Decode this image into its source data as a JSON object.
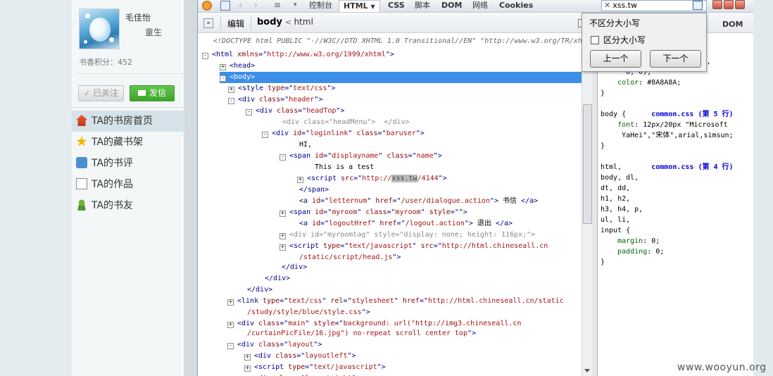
{
  "profile": {
    "username": "毛佳怡",
    "level": "童生",
    "points": "书香积分：452",
    "follow_label": "已关注",
    "message_label": "发信"
  },
  "nav": [
    {
      "label": "TA的书房首页",
      "icon": "home-icon"
    },
    {
      "label": "TA的藏书架",
      "icon": "star-icon"
    },
    {
      "label": "TA的书评",
      "icon": "chat-icon"
    },
    {
      "label": "TA的作品",
      "icon": "document-icon"
    },
    {
      "label": "TA的书友",
      "icon": "user-icon"
    }
  ],
  "firebug": {
    "tabs": [
      "控制台",
      "HTML",
      "CSS",
      "脚本",
      "DOM",
      "网络",
      "Cookies"
    ],
    "edit_label": "编辑",
    "breadcrumb_current": "body",
    "breadcrumb_parent": "html",
    "search_value": "xss.tw",
    "right_tabs_partial": "DOM"
  },
  "search_popup": {
    "option1": "不区分大小写",
    "option2": "区分大小写",
    "prev_label": "上一个",
    "next_label": "下一个"
  },
  "html_tree": {
    "doctype": "<!DOCTYPE html PUBLIC \"-//W3C//DTD XHTML 1.0 Transitional//EN\" \"http://www.w3.org/TR/xh",
    "lines": [
      {
        "toggle": "-",
        "parts": [
          [
            "t",
            "<html "
          ],
          [
            "a",
            "xmlns"
          ],
          [
            "t",
            "=\""
          ],
          [
            "v",
            "http://www.w3.org/1999/xhtml"
          ],
          [
            "t",
            "\">"
          ]
        ]
      },
      {
        "toggle": "+",
        "parts": [
          [
            "t",
            "<head>"
          ]
        ]
      },
      {
        "toggle": "-",
        "selected": true,
        "parts": [
          [
            "w",
            "<body>"
          ]
        ]
      },
      {
        "toggle": "+",
        "parts": [
          [
            "t",
            "<style "
          ],
          [
            "a",
            "type"
          ],
          [
            "t",
            "=\""
          ],
          [
            "v",
            "text/css"
          ],
          [
            "t",
            "\">"
          ]
        ]
      },
      {
        "toggle": "-",
        "parts": [
          [
            "t",
            "<div "
          ],
          [
            "a",
            "class"
          ],
          [
            "t",
            "=\""
          ],
          [
            "v",
            "header"
          ],
          [
            "t",
            "\">"
          ]
        ]
      },
      {
        "toggle": "-",
        "parts": [
          [
            "t",
            "<div "
          ],
          [
            "a",
            "class"
          ],
          [
            "t",
            "=\""
          ],
          [
            "v",
            "headTop"
          ],
          [
            "t",
            "\">"
          ]
        ]
      },
      {
        "toggle": "",
        "parts": [
          [
            "g",
            "<div class=\"headMenu\">  </div>"
          ]
        ]
      },
      {
        "toggle": "-",
        "parts": [
          [
            "t",
            "<div "
          ],
          [
            "a",
            "id"
          ],
          [
            "t",
            "=\""
          ],
          [
            "v",
            "loginlink"
          ],
          [
            "t",
            "\" "
          ],
          [
            "a",
            "class"
          ],
          [
            "t",
            "=\""
          ],
          [
            "v",
            "baruser"
          ],
          [
            "t",
            "\">"
          ]
        ]
      },
      {
        "toggle": "",
        "parts": [
          [
            "k",
            "HI,"
          ]
        ]
      },
      {
        "toggle": "-",
        "parts": [
          [
            "t",
            "<span "
          ],
          [
            "a",
            "id"
          ],
          [
            "t",
            "=\""
          ],
          [
            "v",
            "displayname"
          ],
          [
            "t",
            "\" "
          ],
          [
            "a",
            "class"
          ],
          [
            "t",
            "=\""
          ],
          [
            "v",
            "name"
          ],
          [
            "t",
            "\">"
          ]
        ]
      },
      {
        "toggle": "",
        "parts": [
          [
            "k",
            "This is a test"
          ]
        ]
      },
      {
        "toggle": "+",
        "parts": [
          [
            "t",
            "<script "
          ],
          [
            "a",
            "src"
          ],
          [
            "t",
            "=\""
          ],
          [
            "v",
            "http://"
          ],
          [
            "h",
            "xss.tw"
          ],
          [
            "v",
            "/4144"
          ],
          [
            "t",
            "\">"
          ]
        ]
      },
      {
        "toggle": "",
        "parts": [
          [
            "t",
            "</span>"
          ]
        ]
      },
      {
        "toggle": "",
        "parts": [
          [
            "t",
            "<a "
          ],
          [
            "a",
            "id"
          ],
          [
            "t",
            "=\""
          ],
          [
            "v",
            "letternum"
          ],
          [
            "t",
            "\" "
          ],
          [
            "a",
            "href"
          ],
          [
            "t",
            "=\""
          ],
          [
            "v",
            "/user/dialogue.action"
          ],
          [
            "t",
            "\"> "
          ],
          [
            "k",
            "书信"
          ],
          [
            "t",
            " </a>"
          ]
        ]
      },
      {
        "toggle": "+",
        "parts": [
          [
            "t",
            "<span "
          ],
          [
            "a",
            "id"
          ],
          [
            "t",
            "=\""
          ],
          [
            "v",
            "myroom"
          ],
          [
            "t",
            "\" "
          ],
          [
            "a",
            "class"
          ],
          [
            "t",
            "=\""
          ],
          [
            "v",
            "myroom"
          ],
          [
            "t",
            "\" "
          ],
          [
            "a",
            "style"
          ],
          [
            "t",
            "=\"\">"
          ]
        ]
      },
      {
        "toggle": "",
        "parts": [
          [
            "t",
            "<a "
          ],
          [
            "a",
            "id"
          ],
          [
            "t",
            "=\""
          ],
          [
            "v",
            "logoutHref"
          ],
          [
            "t",
            "\" "
          ],
          [
            "a",
            "href"
          ],
          [
            "t",
            "=\""
          ],
          [
            "v",
            "/logout.action"
          ],
          [
            "t",
            "\"> "
          ],
          [
            "k",
            "退出"
          ],
          [
            "t",
            " </a>"
          ]
        ]
      },
      {
        "toggle": "+",
        "parts": [
          [
            "g",
            "<div id=\"myroomtag\" style=\"display: none; height: 116px;\">"
          ]
        ]
      },
      {
        "toggle": "+",
        "parts": [
          [
            "t",
            "<script "
          ],
          [
            "a",
            "type"
          ],
          [
            "t",
            "=\""
          ],
          [
            "v",
            "text/javascript"
          ],
          [
            "t",
            "\" "
          ],
          [
            "a",
            "src"
          ],
          [
            "t",
            "=\""
          ],
          [
            "v",
            "http://html.chineseall.cn"
          ]
        ]
      },
      {
        "toggle": "",
        "parts": [
          [
            "v",
            "/static/script/head.js"
          ],
          [
            "t",
            "\">"
          ]
        ]
      },
      {
        "toggle": "",
        "parts": [
          [
            "t",
            "</div>"
          ]
        ]
      },
      {
        "toggle": "",
        "parts": [
          [
            "t",
            "</div>"
          ]
        ]
      },
      {
        "toggle": "",
        "parts": [
          [
            "t",
            "</div>"
          ]
        ]
      },
      {
        "toggle": "+",
        "parts": [
          [
            "t",
            "<link "
          ],
          [
            "a",
            "type"
          ],
          [
            "t",
            "=\""
          ],
          [
            "v",
            "text/css"
          ],
          [
            "t",
            "\" "
          ],
          [
            "a",
            "rel"
          ],
          [
            "t",
            "=\""
          ],
          [
            "v",
            "stylesheet"
          ],
          [
            "t",
            "\" "
          ],
          [
            "a",
            "href"
          ],
          [
            "t",
            "=\""
          ],
          [
            "v",
            "http://html.chineseall.cn/static"
          ]
        ]
      },
      {
        "toggle": "",
        "parts": [
          [
            "v",
            "/study/style/blue/style.css"
          ],
          [
            "t",
            "\">"
          ]
        ]
      },
      {
        "toggle": "+",
        "parts": [
          [
            "t",
            "<div "
          ],
          [
            "a",
            "class"
          ],
          [
            "t",
            "=\""
          ],
          [
            "v",
            "main"
          ],
          [
            "t",
            "\" "
          ],
          [
            "a",
            "style"
          ],
          [
            "t",
            "=\""
          ],
          [
            "v",
            "background: url(\"http://img3.chineseall.cn"
          ]
        ]
      },
      {
        "toggle": "",
        "parts": [
          [
            "v",
            "/curtainPicFile/16.jpg\") no-repeat scroll center top"
          ],
          [
            "t",
            "\">"
          ]
        ]
      },
      {
        "toggle": "-",
        "parts": [
          [
            "t",
            "<div "
          ],
          [
            "a",
            "class"
          ],
          [
            "t",
            "=\""
          ],
          [
            "v",
            "layout"
          ],
          [
            "t",
            "\">"
          ]
        ]
      },
      {
        "toggle": "+",
        "parts": [
          [
            "t",
            "<div "
          ],
          [
            "a",
            "class"
          ],
          [
            "t",
            "=\""
          ],
          [
            "v",
            "layoutleft"
          ],
          [
            "t",
            "\">"
          ]
        ]
      },
      {
        "toggle": "+",
        "parts": [
          [
            "t",
            "<script "
          ],
          [
            "a",
            "type"
          ],
          [
            "t",
            "=\""
          ],
          [
            "v",
            "text/javascript"
          ],
          [
            "t",
            "\">"
          ]
        ]
      },
      {
        "toggle": "-",
        "parts": [
          [
            "t",
            "<div "
          ],
          [
            "a",
            "class"
          ],
          [
            "t",
            "=\""
          ],
          [
            "v",
            "layoutright"
          ],
          [
            "t",
            "\">"
          ]
        ]
      }
    ]
  },
  "css_rules": {
    "lines": [
      [
        [
          "k",
          "                  "
        ],
        [
          "f",
          "第 3 行"
        ],
        [
          "k",
          ")"
        ]
      ],
      [
        [
          "k",
          "                  "
        ],
        [
          "k",
          "png\")"
        ]
      ],
      [
        [
          "k",
          "                  "
        ],
        [
          "k",
          "ba(0, 0,"
        ]
      ],
      [
        [
          "k",
          "      0, 0);"
        ]
      ],
      [
        [
          "p",
          "    color"
        ],
        [
          "k",
          ": "
        ],
        [
          "k",
          "#8A8A8A;"
        ]
      ],
      [
        [
          "k",
          "}"
        ]
      ],
      [
        [
          "k",
          ""
        ]
      ],
      [
        [
          "k",
          "body {      "
        ],
        [
          "f",
          "common.css (第 5 行)"
        ]
      ],
      [
        [
          "p",
          "    font"
        ],
        [
          "k",
          ": 12px/20px \"Microsoft"
        ]
      ],
      [
        [
          "k",
          "     YaHei\",\"宋体\",arial,simsun;"
        ]
      ],
      [
        [
          "k",
          "}"
        ]
      ],
      [
        [
          "k",
          ""
        ]
      ],
      [
        [
          "k",
          "html,       "
        ],
        [
          "f",
          "common.css (第 4 行)"
        ]
      ],
      [
        [
          "k",
          "body, dl,"
        ]
      ],
      [
        [
          "k",
          "dt, dd,"
        ]
      ],
      [
        [
          "k",
          "h1, h2,"
        ]
      ],
      [
        [
          "k",
          "h3, h4, p,"
        ]
      ],
      [
        [
          "k",
          "ul, li,"
        ]
      ],
      [
        [
          "k",
          "input {"
        ]
      ],
      [
        [
          "p",
          "    margin"
        ],
        [
          "k",
          ": 0;"
        ]
      ],
      [
        [
          "p",
          "    padding"
        ],
        [
          "k",
          ": 0;"
        ]
      ],
      [
        [
          "k",
          "}"
        ]
      ]
    ]
  },
  "watermark": "www.wooyun.org"
}
